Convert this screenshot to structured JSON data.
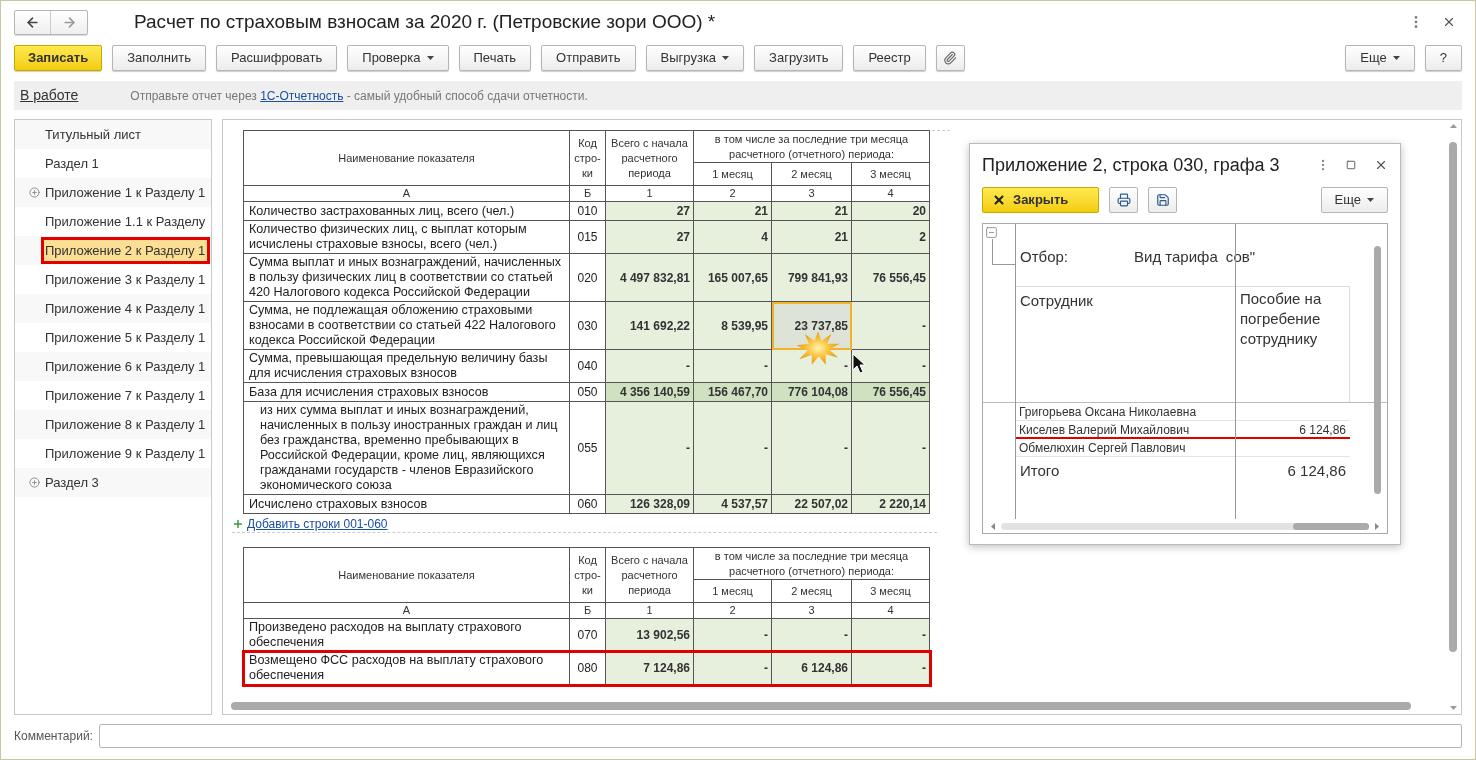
{
  "window": {
    "title": "Расчет по страховым взносам за 2020 г. (Петровские зори ООО) *"
  },
  "toolbar": [
    {
      "label": "Записать",
      "kind": "primary"
    },
    {
      "label": "Заполнить",
      "kind": "plain"
    },
    {
      "label": "Расшифровать",
      "kind": "plain"
    },
    {
      "label": "Проверка",
      "kind": "dropdown"
    },
    {
      "label": "Печать",
      "kind": "plain"
    },
    {
      "label": "Отправить",
      "kind": "plain"
    },
    {
      "label": "Выгрузка",
      "kind": "dropdown"
    },
    {
      "label": "Загрузить",
      "kind": "plain"
    },
    {
      "label": "Реестр",
      "kind": "plain"
    },
    {
      "kind": "attach"
    }
  ],
  "toolbar_right": [
    {
      "label": "Еще",
      "kind": "dropdown"
    },
    {
      "label": "?",
      "kind": "plain"
    }
  ],
  "info_bar": {
    "state": "В работе",
    "text_before": "Отправьте отчет через ",
    "link": "1С-Отчетность",
    "text_after": " - самый удобный способ сдачи отчетности."
  },
  "sidebar": {
    "items": [
      {
        "label": "Титульный лист",
        "expandable": false,
        "selected": false
      },
      {
        "label": "Раздел 1",
        "expandable": false,
        "selected": false
      },
      {
        "label": "Приложение 1 к Разделу 1",
        "expandable": true,
        "selected": false
      },
      {
        "label": "Приложение 1.1 к Разделу",
        "expandable": false,
        "selected": false
      },
      {
        "label": "Приложение 2 к Разделу 1",
        "expandable": false,
        "selected": true
      },
      {
        "label": "Приложение 3 к Разделу 1",
        "expandable": false,
        "selected": false
      },
      {
        "label": "Приложение 4 к Разделу 1",
        "expandable": false,
        "selected": false
      },
      {
        "label": "Приложение 5 к Разделу 1",
        "expandable": false,
        "selected": false
      },
      {
        "label": "Приложение 6 к Разделу 1",
        "expandable": false,
        "selected": false
      },
      {
        "label": "Приложение 7 к Разделу 1",
        "expandable": false,
        "selected": false
      },
      {
        "label": "Приложение 8 к Разделу 1",
        "expandable": false,
        "selected": false
      },
      {
        "label": "Приложение 9 к Разделу 1",
        "expandable": false,
        "selected": false
      },
      {
        "label": "Раздел 3",
        "expandable": true,
        "selected": false
      }
    ]
  },
  "tables": [
    {
      "columns": {
        "name": "Наименование показателя",
        "code": "Код стро-ки",
        "total": "Всего с начала расчетного периода",
        "recent": "в том числе за последние три месяца расчетного (отчетного) периода:",
        "months": [
          "1 месяц",
          "2 месяц",
          "3 месяц"
        ],
        "letters": [
          "А",
          "Б",
          "1",
          "2",
          "3",
          "4"
        ]
      },
      "rows": [
        {
          "name": "Количество застрахованных лиц, всего (чел.)",
          "code": "010",
          "kind": "plain",
          "marked": false,
          "cells": [
            {
              "text": "27",
              "selected": false
            },
            {
              "text": "21",
              "selected": false
            },
            {
              "text": "21",
              "selected": false
            },
            {
              "text": "20",
              "selected": false
            }
          ]
        },
        {
          "name": "Количество физических лиц, с выплат которым исчислены страховые взносы, всего (чел.)",
          "code": "015",
          "kind": "plain",
          "marked": false,
          "cells": [
            {
              "text": "27",
              "selected": false
            },
            {
              "text": "4",
              "selected": false
            },
            {
              "text": "21",
              "selected": false
            },
            {
              "text": "2",
              "selected": false
            }
          ]
        },
        {
          "name": "Сумма выплат и иных вознаграждений, начисленных в пользу физических лиц в соответствии со статьей 420 Налогового кодекса Российской Федерации",
          "code": "020",
          "kind": "plain",
          "marked": false,
          "cells": [
            {
              "text": "4 497 832,81",
              "selected": false
            },
            {
              "text": "165 007,65",
              "selected": false
            },
            {
              "text": "799 841,93",
              "selected": false
            },
            {
              "text": "76 556,45",
              "selected": false
            }
          ]
        },
        {
          "name": "Сумма, не подлежащая обложению страховыми взносами в соответствии со статьей 422 Налогового кодекса Российской Федерации",
          "code": "030",
          "kind": "plain",
          "marked": false,
          "cells": [
            {
              "text": "141 692,22",
              "selected": false
            },
            {
              "text": "8 539,95",
              "selected": false
            },
            {
              "text": "23 737,85",
              "selected": true
            },
            {
              "text": "-",
              "selected": false
            }
          ]
        },
        {
          "name": "Сумма, превышающая предельную величину базы для исчисления страховых взносов",
          "code": "040",
          "kind": "plain",
          "marked": false,
          "cells": [
            {
              "text": "-",
              "selected": false
            },
            {
              "text": "-",
              "selected": false
            },
            {
              "text": "-",
              "selected": false
            },
            {
              "text": "-",
              "selected": false
            }
          ]
        },
        {
          "name": "База для исчисления страховых взносов",
          "code": "050",
          "kind": "total",
          "marked": false,
          "cells": [
            {
              "text": "4 356 140,59",
              "selected": false
            },
            {
              "text": "156 467,70",
              "selected": false
            },
            {
              "text": "776 104,08",
              "selected": false
            },
            {
              "text": "76 556,45",
              "selected": false
            }
          ]
        },
        {
          "name": "из них сумма выплат и иных вознаграждений, начисленных в пользу иностранных граждан и лиц без гражданства, временно пребывающих в Российской Федерации, кроме лиц, являющихся гражданами государств - членов Евразийского экономического союза",
          "code": "055",
          "kind": "sub",
          "marked": false,
          "cells": [
            {
              "text": "-",
              "selected": false
            },
            {
              "text": "-",
              "selected": false
            },
            {
              "text": "-",
              "selected": false
            },
            {
              "text": "-",
              "selected": false
            }
          ]
        },
        {
          "name": "Исчислено страховых взносов",
          "code": "060",
          "kind": "plain",
          "marked": false,
          "cells": [
            {
              "text": "126 328,09",
              "selected": false
            },
            {
              "text": "4 537,57",
              "selected": false
            },
            {
              "text": "22 507,02",
              "selected": false
            },
            {
              "text": "2 220,14",
              "selected": false
            }
          ]
        }
      ],
      "add_link": "Добавить строки 001-060"
    },
    {
      "columns": {
        "name": "Наименование показателя",
        "code": "Код стро-ки",
        "total": "Всего с начала расчетного периода",
        "recent": "в том числе за последние три месяца расчетного (отчетного) периода:",
        "months": [
          "1 месяц",
          "2 месяц",
          "3 месяц"
        ],
        "letters": [
          "А",
          "Б",
          "1",
          "2",
          "3",
          "4"
        ]
      },
      "rows": [
        {
          "name": "Произведено расходов на выплату страхового обеспечения",
          "code": "070",
          "kind": "plain",
          "marked": false,
          "cells": [
            {
              "text": "13 902,56",
              "selected": false
            },
            {
              "text": "-",
              "selected": false
            },
            {
              "text": "-",
              "selected": false
            },
            {
              "text": "-",
              "selected": false
            }
          ]
        },
        {
          "name": "Возмещено ФСС расходов на выплату страхового обеспечения",
          "code": "080",
          "kind": "plain",
          "marked": true,
          "cells": [
            {
              "text": "7 124,86",
              "selected": false
            },
            {
              "text": "-",
              "selected": false
            },
            {
              "text": "6 124,86",
              "selected": false
            },
            {
              "text": "-",
              "selected": false
            }
          ]
        }
      ]
    }
  ],
  "popup": {
    "title": "Приложение 2, строка 030, графа 3",
    "close_button": "Закрыть",
    "more_button": "Еще",
    "filter": {
      "label": "Отбор:",
      "value": "Вид тарифа",
      "value_tail": "сов\""
    },
    "columns": [
      "Сотрудник",
      "Пособие на погребение сотруднику"
    ],
    "rows": [
      {
        "name": "Григорьева Оксана Николаевна",
        "marked": false
      },
      {
        "name": "Киселев Валерий Михайлович",
        "amount": "6 124,86",
        "marked": true
      },
      {
        "name": "Обмелюхин Сергей Павлович",
        "marked": false
      }
    ],
    "total": {
      "label": "Итого",
      "amount": "6 124,86"
    }
  },
  "comment": {
    "label": "Комментарий:"
  }
}
